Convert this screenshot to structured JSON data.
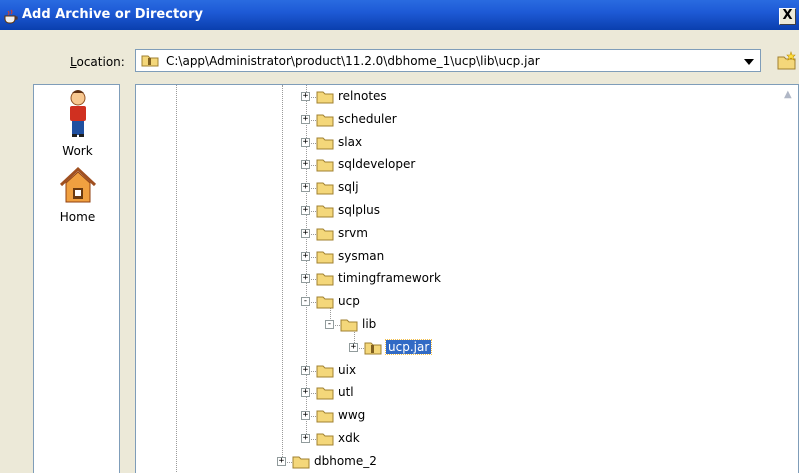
{
  "window": {
    "title": "Add Archive or Directory",
    "close_label": "X"
  },
  "location": {
    "label_prefix": "",
    "label_mnemonic": "L",
    "label_rest": "ocation:",
    "path": "C:\\app\\Administrator\\product\\11.2.0\\dbhome_1\\ucp\\lib\\ucp.jar"
  },
  "shortcuts": [
    {
      "label": "Work",
      "icon": "work-person-icon"
    },
    {
      "label": "Home",
      "icon": "home-house-icon"
    }
  ],
  "tree": {
    "items": [
      {
        "label": "relnotes",
        "expander": "+"
      },
      {
        "label": "scheduler",
        "expander": "+"
      },
      {
        "label": "slax",
        "expander": "+"
      },
      {
        "label": "sqldeveloper",
        "expander": "+"
      },
      {
        "label": "sqlj",
        "expander": "+"
      },
      {
        "label": "sqlplus",
        "expander": "+"
      },
      {
        "label": "srvm",
        "expander": "+"
      },
      {
        "label": "sysman",
        "expander": "+"
      },
      {
        "label": "timingframework",
        "expander": "+"
      },
      {
        "label": "ucp",
        "expander": "-"
      },
      {
        "label": "lib",
        "expander": "-"
      },
      {
        "label": "ucp.jar",
        "expander": "+",
        "selected": true
      },
      {
        "label": "uix",
        "expander": "+"
      },
      {
        "label": "utl",
        "expander": "+"
      },
      {
        "label": "wwg",
        "expander": "+"
      },
      {
        "label": "xdk",
        "expander": "+"
      },
      {
        "label": "dbhome_2",
        "expander": "+"
      }
    ]
  },
  "colors": {
    "titlebar": "#0a3fae",
    "selection": "#316ac5",
    "folder": "#f4d77a"
  }
}
